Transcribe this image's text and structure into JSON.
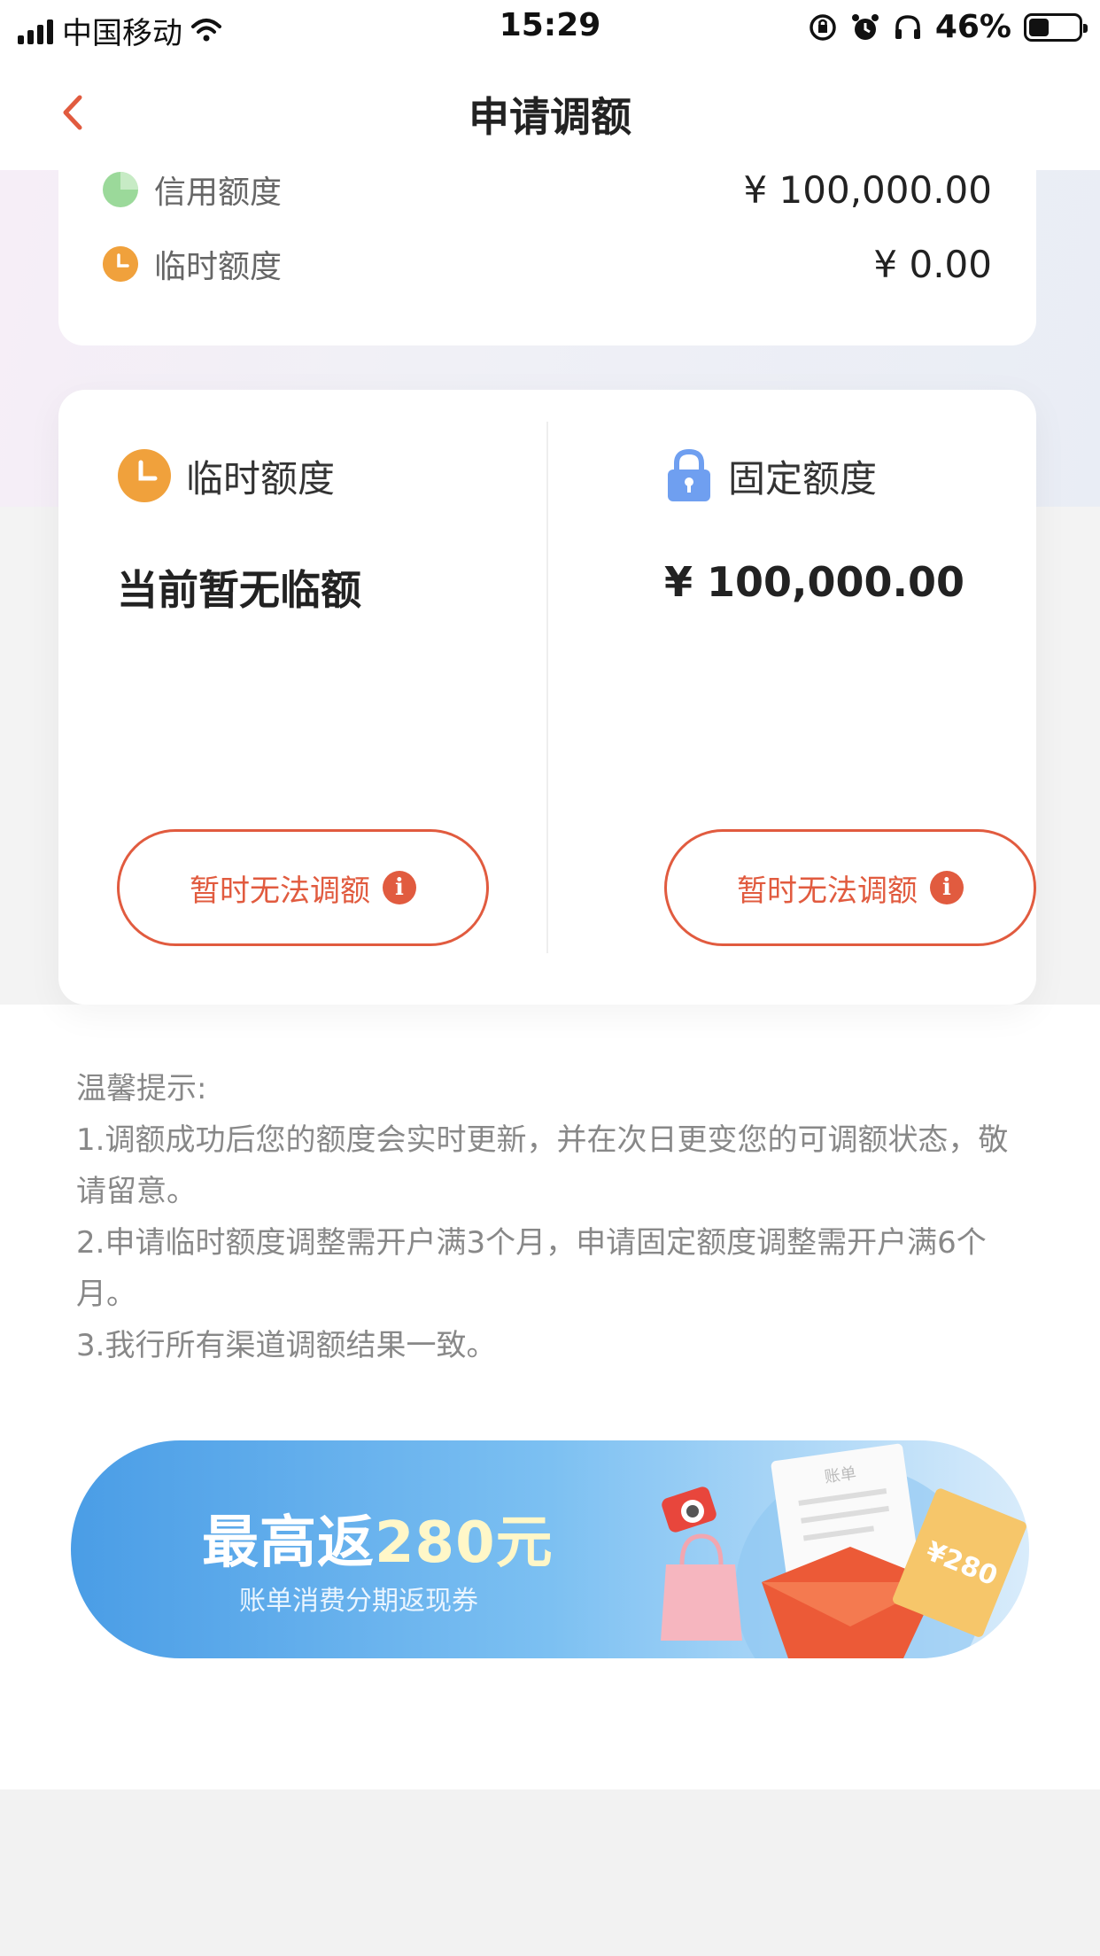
{
  "status_bar": {
    "carrier": "中国移动",
    "time": "15:29",
    "battery_percent": "46%"
  },
  "nav": {
    "title": "申请调额",
    "back_icon": "chevron-left-icon"
  },
  "summary": {
    "rows": [
      {
        "label": "信用额度",
        "amount": "¥ 100,000.00"
      },
      {
        "label": "临时额度",
        "amount": "¥ 0.00"
      }
    ]
  },
  "limits": {
    "temporary": {
      "title": "临时额度",
      "value": "当前暂无临额",
      "button": "暂时无法调额",
      "icon": "clock-icon"
    },
    "fixed": {
      "title": "固定额度",
      "value": "¥ 100,000.00",
      "button": "暂时无法调额",
      "icon": "lock-icon"
    }
  },
  "tips": {
    "heading": "温馨提示:",
    "items": [
      "1.调额成功后您的额度会实时更新，并在次日更变您的可调额状态，敬请留意。",
      "2.申请临时额度调整需开户满3个月，申请固定额度调整需开户满6个月。",
      "3.我行所有渠道调额结果一致。"
    ]
  },
  "banner": {
    "title_prefix": "最高返",
    "title_amount": "280元",
    "subtitle": "账单消费分期返现券",
    "art_text": "账单",
    "coupon_text": "¥280"
  },
  "colors": {
    "accent": "#e15b3f",
    "orange": "#f0a13c",
    "green": "#9bd99a",
    "lock_blue": "#6f9ff0",
    "banner_blue": "#4a9de6"
  }
}
